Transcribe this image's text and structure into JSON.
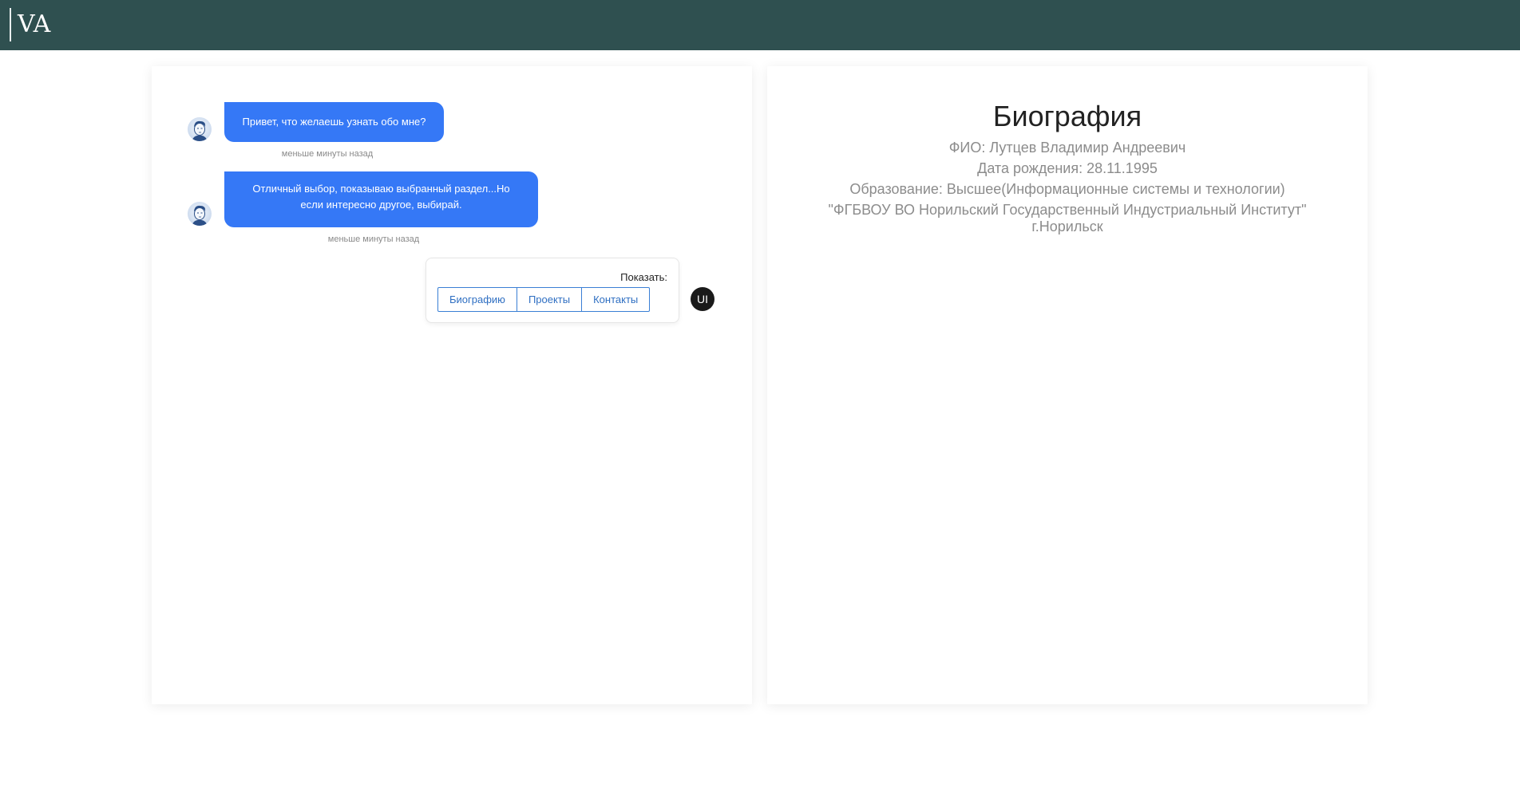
{
  "header": {
    "logo": "VA",
    "background": "#2f5050"
  },
  "chat": {
    "messages": [
      {
        "text": "Привет, что желаешь узнать обо мне?",
        "time": "меньше минуты назад"
      },
      {
        "text": "Отличный выбор, показываю выбранный раздел...Но если интересно другое, выбирай.",
        "time": "меньше минуты назад"
      }
    ],
    "choice": {
      "label": "Показать:",
      "options": [
        "Биографию",
        "Проекты",
        "Контакты"
      ]
    },
    "user_avatar": "UI",
    "bubble_color": "#3578f6"
  },
  "bio": {
    "title": "Биография",
    "lines": [
      "ФИО: Лутцев Владимир Андреевич",
      "Дата рождения: 28.11.1995",
      "Образование: Высшее(Информационные системы и технологии)",
      "\"ФГБВОУ ВО Норильский Государственный Индустриальный Институт\"",
      "г.Норильск"
    ]
  }
}
